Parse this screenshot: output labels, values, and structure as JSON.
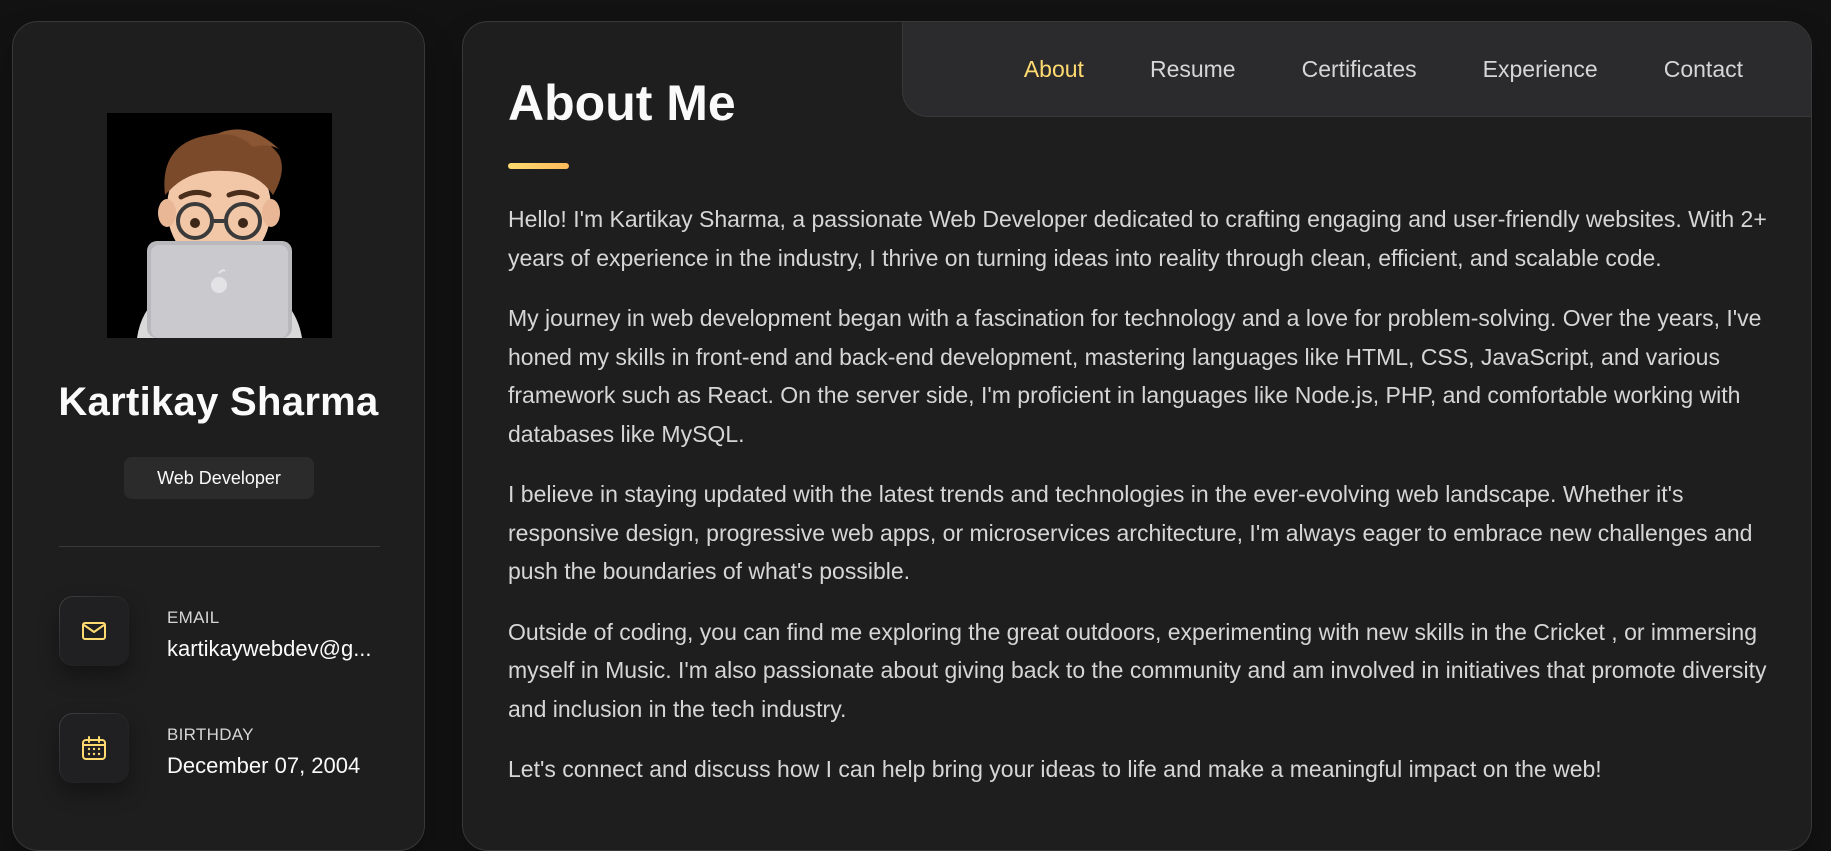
{
  "profile": {
    "name": "Kartikay Sharma",
    "title": "Web Developer",
    "avatar_icon": "memoji-avatar-with-laptop"
  },
  "contacts": {
    "email": {
      "label": "EMAIL",
      "value": "kartikaywebdev@g...",
      "icon": "envelope-icon"
    },
    "birthday": {
      "label": "BIRTHDAY",
      "value": "December 07, 2004",
      "icon": "calendar-icon"
    }
  },
  "nav": {
    "items": [
      "About",
      "Resume",
      "Certificates",
      "Experience",
      "Contact"
    ],
    "active": "About"
  },
  "about": {
    "heading": "About Me",
    "paragraphs": [
      "Hello! I'm Kartikay Sharma, a passionate Web Developer dedicated to crafting engaging and user-friendly websites. With 2+ years of experience in the industry, I thrive on turning ideas into reality through clean, efficient, and scalable code.",
      "My journey in web development began with a fascination for technology and a love for problem-solving. Over the years, I've honed my skills in front-end and back-end development, mastering languages like HTML, CSS, JavaScript, and various framework such as React. On the server side, I'm proficient in languages like Node.js, PHP, and comfortable working with databases like MySQL.",
      "I believe in staying updated with the latest trends and technologies in the ever-evolving web landscape. Whether it's responsive design, progressive web apps, or microservices architecture, I'm always eager to embrace new challenges and push the boundaries of what's possible.",
      "Outside of coding, you can find me exploring the great outdoors, experimenting with new skills in the Cricket , or immersing myself in Music. I'm also passionate about giving back to the community and am involved in initiatives that promote diversity and inclusion in the tech industry.",
      "Let's connect and discuss how I can help bring your ideas to life and make a meaningful impact on the web!"
    ]
  },
  "colors": {
    "accent": "#ffdb70",
    "background": "#121212",
    "panel": "#1e1e1f",
    "text": "#d6d6d6"
  }
}
